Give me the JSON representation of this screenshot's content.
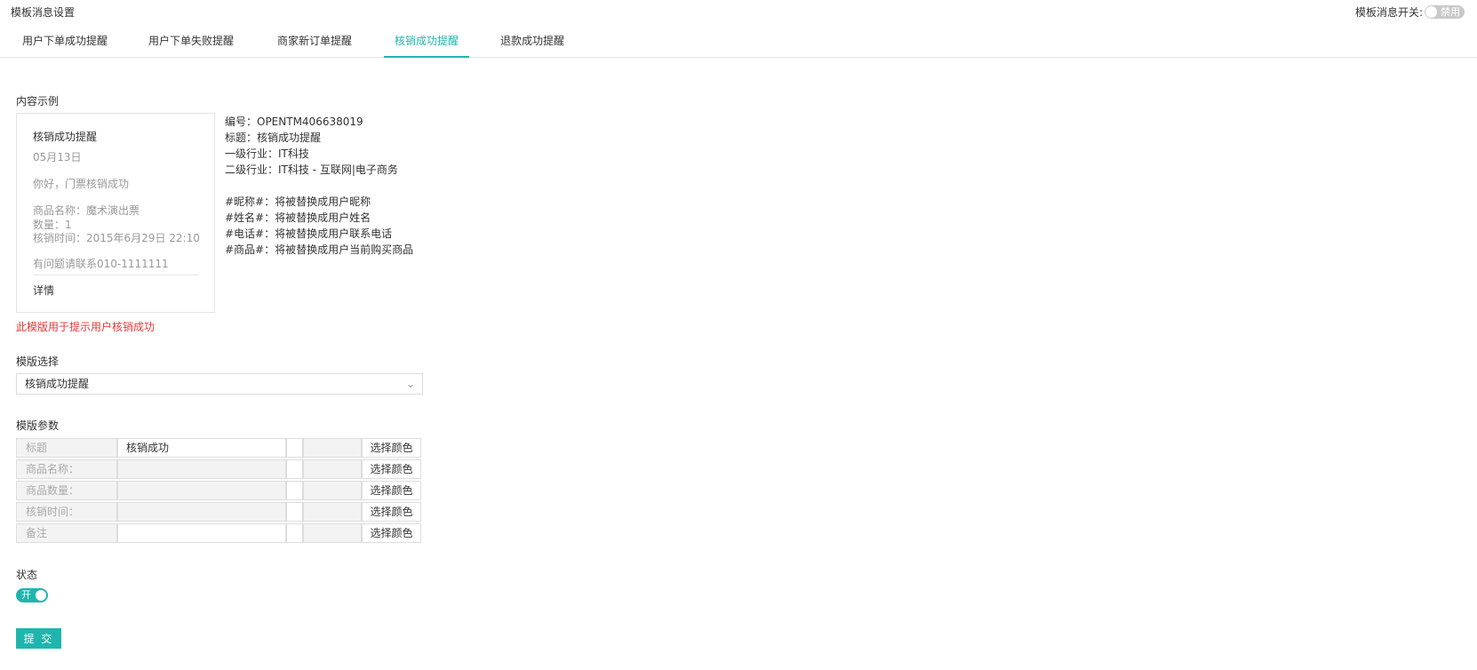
{
  "header": {
    "title": "模板消息设置",
    "master_switch_label": "模板消息开关:",
    "master_switch_state": "禁用"
  },
  "tabs": [
    {
      "label": "用户下单成功提醒",
      "active": false
    },
    {
      "label": "用户下单失败提醒",
      "active": false
    },
    {
      "label": "商家新订单提醒",
      "active": false
    },
    {
      "label": "核销成功提醒",
      "active": true
    },
    {
      "label": "退款成功提醒",
      "active": false
    }
  ],
  "content_example": {
    "label": "内容示例",
    "preview": {
      "title": "核销成功提醒",
      "date": "05月13日",
      "greeting": "你好，门票核销成功",
      "product": "商品名称：魔术演出票",
      "quantity": "数量：1",
      "time": "核销时间：2015年6月29日 22:10",
      "contact": "有问题请联系010-1111111",
      "detail": "详情"
    },
    "info": {
      "number": "编号：OPENTM406638019",
      "title": "标题：核销成功提醒",
      "industry1": "一级行业：IT科技",
      "industry2": "二级行业：IT科技 - 互联网|电子商务",
      "var_nickname": "#昵称#：将被替换成用户昵称",
      "var_name": "#姓名#：将被替换成用户姓名",
      "var_phone": "#电话#：将被替换成用户联系电话",
      "var_product": "#商品#：将被替换成用户当前购买商品"
    },
    "warning": "此模版用于提示用户核销成功"
  },
  "template_select": {
    "label": "模版选择",
    "selected": "核销成功提醒"
  },
  "params": {
    "label": "模版参数",
    "color_button": "选择颜色",
    "rows": [
      {
        "name": "标题",
        "value": "核销成功"
      },
      {
        "name": "商品名称：",
        "value": ""
      },
      {
        "name": "商品数量：",
        "value": ""
      },
      {
        "name": "核销时间：",
        "value": ""
      },
      {
        "name": "备注",
        "value": ""
      }
    ]
  },
  "status": {
    "label": "状态",
    "toggle": "开"
  },
  "submit": "提 交",
  "colors": {
    "accent": "#1fb5ad",
    "warning": "#e53935"
  }
}
